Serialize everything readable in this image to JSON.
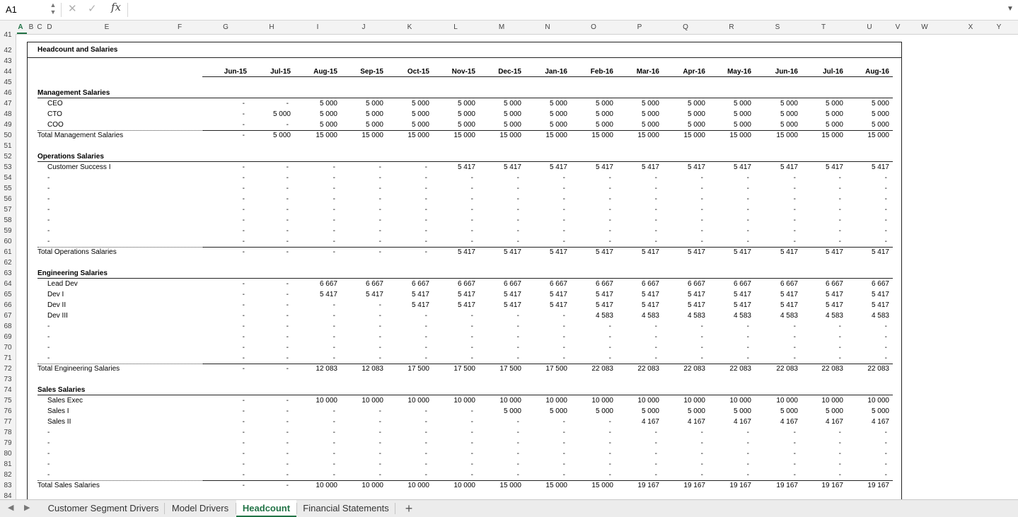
{
  "formula_bar": {
    "name_box": "A1",
    "cancel_icon": "✕",
    "confirm_icon": "✓",
    "fx_label": "fx",
    "formula": ""
  },
  "columns": [
    "A",
    "B",
    "C",
    "D",
    "E",
    "F",
    "G",
    "H",
    "I",
    "J",
    "K",
    "L",
    "M",
    "N",
    "O",
    "P",
    "Q",
    "R",
    "S",
    "T",
    "U",
    "V",
    "W",
    "X",
    "Y"
  ],
  "rows": [
    "41",
    "42",
    "43",
    "44",
    "45",
    "46",
    "47",
    "48",
    "49",
    "50",
    "51",
    "52",
    "53",
    "54",
    "55",
    "56",
    "57",
    "58",
    "59",
    "60",
    "61",
    "62",
    "63",
    "64",
    "65",
    "66",
    "67",
    "68",
    "69",
    "70",
    "71",
    "72",
    "73",
    "74",
    "75",
    "76",
    "77",
    "78",
    "79",
    "80",
    "81",
    "82",
    "83",
    "84"
  ],
  "section_title": "Headcount and Salaries",
  "months": [
    "Jun-15",
    "Jul-15",
    "Aug-15",
    "Sep-15",
    "Oct-15",
    "Nov-15",
    "Dec-15",
    "Jan-16",
    "Feb-16",
    "Mar-16",
    "Apr-16",
    "May-16",
    "Jun-16",
    "Jul-16",
    "Aug-16"
  ],
  "table_rows": [
    {
      "row": "46",
      "label": "Management Salaries",
      "type": "header",
      "values": []
    },
    {
      "row": "47",
      "label": "CEO",
      "type": "item",
      "values": [
        "-",
        "-",
        "5 000",
        "5 000",
        "5 000",
        "5 000",
        "5 000",
        "5 000",
        "5 000",
        "5 000",
        "5 000",
        "5 000",
        "5 000",
        "5 000",
        "5 000"
      ]
    },
    {
      "row": "48",
      "label": "CTO",
      "type": "item",
      "values": [
        "-",
        "5 000",
        "5 000",
        "5 000",
        "5 000",
        "5 000",
        "5 000",
        "5 000",
        "5 000",
        "5 000",
        "5 000",
        "5 000",
        "5 000",
        "5 000",
        "5 000"
      ]
    },
    {
      "row": "49",
      "label": "COO",
      "type": "item",
      "values": [
        "-",
        "-",
        "5 000",
        "5 000",
        "5 000",
        "5 000",
        "5 000",
        "5 000",
        "5 000",
        "5 000",
        "5 000",
        "5 000",
        "5 000",
        "5 000",
        "5 000"
      ]
    },
    {
      "row": "50",
      "label": "Total Management Salaries",
      "type": "total",
      "values": [
        "-",
        "5 000",
        "15 000",
        "15 000",
        "15 000",
        "15 000",
        "15 000",
        "15 000",
        "15 000",
        "15 000",
        "15 000",
        "15 000",
        "15 000",
        "15 000",
        "15 000"
      ]
    },
    {
      "row": "52",
      "label": "Operations Salaries",
      "type": "header",
      "values": []
    },
    {
      "row": "53",
      "label": "Customer Success I",
      "type": "item",
      "values": [
        "-",
        "-",
        "-",
        "-",
        "-",
        "5 417",
        "5 417",
        "5 417",
        "5 417",
        "5 417",
        "5 417",
        "5 417",
        "5 417",
        "5 417",
        "5 417"
      ]
    },
    {
      "row": "54",
      "label": "-",
      "type": "item",
      "values": [
        "-",
        "-",
        "-",
        "-",
        "-",
        "-",
        "-",
        "-",
        "-",
        "-",
        "-",
        "-",
        "-",
        "-",
        "-"
      ]
    },
    {
      "row": "55",
      "label": "-",
      "type": "item",
      "values": [
        "-",
        "-",
        "-",
        "-",
        "-",
        "-",
        "-",
        "-",
        "-",
        "-",
        "-",
        "-",
        "-",
        "-",
        "-"
      ]
    },
    {
      "row": "56",
      "label": "-",
      "type": "item",
      "values": [
        "-",
        "-",
        "-",
        "-",
        "-",
        "-",
        "-",
        "-",
        "-",
        "-",
        "-",
        "-",
        "-",
        "-",
        "-"
      ]
    },
    {
      "row": "57",
      "label": "-",
      "type": "item",
      "values": [
        "-",
        "-",
        "-",
        "-",
        "-",
        "-",
        "-",
        "-",
        "-",
        "-",
        "-",
        "-",
        "-",
        "-",
        "-"
      ]
    },
    {
      "row": "58",
      "label": "-",
      "type": "item",
      "values": [
        "-",
        "-",
        "-",
        "-",
        "-",
        "-",
        "-",
        "-",
        "-",
        "-",
        "-",
        "-",
        "-",
        "-",
        "-"
      ]
    },
    {
      "row": "59",
      "label": "-",
      "type": "item",
      "values": [
        "-",
        "-",
        "-",
        "-",
        "-",
        "-",
        "-",
        "-",
        "-",
        "-",
        "-",
        "-",
        "-",
        "-",
        "-"
      ]
    },
    {
      "row": "60",
      "label": "-",
      "type": "item",
      "values": [
        "-",
        "-",
        "-",
        "-",
        "-",
        "-",
        "-",
        "-",
        "-",
        "-",
        "-",
        "-",
        "-",
        "-",
        "-"
      ]
    },
    {
      "row": "61",
      "label": "Total Operations Salaries",
      "type": "total",
      "values": [
        "-",
        "-",
        "-",
        "-",
        "-",
        "5 417",
        "5 417",
        "5 417",
        "5 417",
        "5 417",
        "5 417",
        "5 417",
        "5 417",
        "5 417",
        "5 417"
      ]
    },
    {
      "row": "63",
      "label": "Engineering Salaries",
      "type": "header",
      "values": []
    },
    {
      "row": "64",
      "label": "Lead Dev",
      "type": "item",
      "values": [
        "-",
        "-",
        "6 667",
        "6 667",
        "6 667",
        "6 667",
        "6 667",
        "6 667",
        "6 667",
        "6 667",
        "6 667",
        "6 667",
        "6 667",
        "6 667",
        "6 667"
      ]
    },
    {
      "row": "65",
      "label": "Dev I",
      "type": "item",
      "values": [
        "-",
        "-",
        "5 417",
        "5 417",
        "5 417",
        "5 417",
        "5 417",
        "5 417",
        "5 417",
        "5 417",
        "5 417",
        "5 417",
        "5 417",
        "5 417",
        "5 417"
      ]
    },
    {
      "row": "66",
      "label": "Dev II",
      "type": "item",
      "values": [
        "-",
        "-",
        "-",
        "-",
        "5 417",
        "5 417",
        "5 417",
        "5 417",
        "5 417",
        "5 417",
        "5 417",
        "5 417",
        "5 417",
        "5 417",
        "5 417"
      ]
    },
    {
      "row": "67",
      "label": "Dev III",
      "type": "item",
      "values": [
        "-",
        "-",
        "-",
        "-",
        "-",
        "-",
        "-",
        "-",
        "4 583",
        "4 583",
        "4 583",
        "4 583",
        "4 583",
        "4 583",
        "4 583"
      ]
    },
    {
      "row": "68",
      "label": "-",
      "type": "item",
      "values": [
        "-",
        "-",
        "-",
        "-",
        "-",
        "-",
        "-",
        "-",
        "-",
        "-",
        "-",
        "-",
        "-",
        "-",
        "-"
      ]
    },
    {
      "row": "69",
      "label": "-",
      "type": "item",
      "values": [
        "-",
        "-",
        "-",
        "-",
        "-",
        "-",
        "-",
        "-",
        "-",
        "-",
        "-",
        "-",
        "-",
        "-",
        "-"
      ]
    },
    {
      "row": "70",
      "label": "-",
      "type": "item",
      "values": [
        "-",
        "-",
        "-",
        "-",
        "-",
        "-",
        "-",
        "-",
        "-",
        "-",
        "-",
        "-",
        "-",
        "-",
        "-"
      ]
    },
    {
      "row": "71",
      "label": "-",
      "type": "item",
      "values": [
        "-",
        "-",
        "-",
        "-",
        "-",
        "-",
        "-",
        "-",
        "-",
        "-",
        "-",
        "-",
        "-",
        "-",
        "-"
      ]
    },
    {
      "row": "72",
      "label": "Total Engineering Salaries",
      "type": "total",
      "values": [
        "-",
        "-",
        "12 083",
        "12 083",
        "17 500",
        "17 500",
        "17 500",
        "17 500",
        "22 083",
        "22 083",
        "22 083",
        "22 083",
        "22 083",
        "22 083",
        "22 083"
      ]
    },
    {
      "row": "74",
      "label": "Sales Salaries",
      "type": "header",
      "values": []
    },
    {
      "row": "75",
      "label": "Sales Exec",
      "type": "item",
      "values": [
        "-",
        "-",
        "10 000",
        "10 000",
        "10 000",
        "10 000",
        "10 000",
        "10 000",
        "10 000",
        "10 000",
        "10 000",
        "10 000",
        "10 000",
        "10 000",
        "10 000"
      ]
    },
    {
      "row": "76",
      "label": "Sales I",
      "type": "item",
      "values": [
        "-",
        "-",
        "-",
        "-",
        "-",
        "-",
        "5 000",
        "5 000",
        "5 000",
        "5 000",
        "5 000",
        "5 000",
        "5 000",
        "5 000",
        "5 000"
      ]
    },
    {
      "row": "77",
      "label": "Sales II",
      "type": "item",
      "values": [
        "-",
        "-",
        "-",
        "-",
        "-",
        "-",
        "-",
        "-",
        "-",
        "4 167",
        "4 167",
        "4 167",
        "4 167",
        "4 167",
        "4 167"
      ]
    },
    {
      "row": "78",
      "label": "-",
      "type": "item",
      "values": [
        "-",
        "-",
        "-",
        "-",
        "-",
        "-",
        "-",
        "-",
        "-",
        "-",
        "-",
        "-",
        "-",
        "-",
        "-"
      ]
    },
    {
      "row": "79",
      "label": "-",
      "type": "item",
      "values": [
        "-",
        "-",
        "-",
        "-",
        "-",
        "-",
        "-",
        "-",
        "-",
        "-",
        "-",
        "-",
        "-",
        "-",
        "-"
      ]
    },
    {
      "row": "80",
      "label": "-",
      "type": "item",
      "values": [
        "-",
        "-",
        "-",
        "-",
        "-",
        "-",
        "-",
        "-",
        "-",
        "-",
        "-",
        "-",
        "-",
        "-",
        "-"
      ]
    },
    {
      "row": "81",
      "label": "-",
      "type": "item",
      "values": [
        "-",
        "-",
        "-",
        "-",
        "-",
        "-",
        "-",
        "-",
        "-",
        "-",
        "-",
        "-",
        "-",
        "-",
        "-"
      ]
    },
    {
      "row": "82",
      "label": "-",
      "type": "item",
      "values": [
        "-",
        "-",
        "-",
        "-",
        "-",
        "-",
        "-",
        "-",
        "-",
        "-",
        "-",
        "-",
        "-",
        "-",
        "-"
      ]
    },
    {
      "row": "83",
      "label": "Total Sales Salaries",
      "type": "total",
      "values": [
        "-",
        "-",
        "10 000",
        "10 000",
        "10 000",
        "10 000",
        "15 000",
        "15 000",
        "15 000",
        "19 167",
        "19 167",
        "19 167",
        "19 167",
        "19 167",
        "19 167"
      ]
    }
  ],
  "sheet_tabs": {
    "tabs": [
      "Customer Segment Drivers",
      "Model Drivers",
      "Headcount",
      "Financial Statements"
    ],
    "active": "Headcount",
    "add_icon": "+",
    "prev_icon": "◀",
    "next_icon": "▶"
  },
  "colors": {
    "accent": "#217346",
    "header_bg": "#f3f3f3",
    "grid_line": "#d0d0d0"
  }
}
